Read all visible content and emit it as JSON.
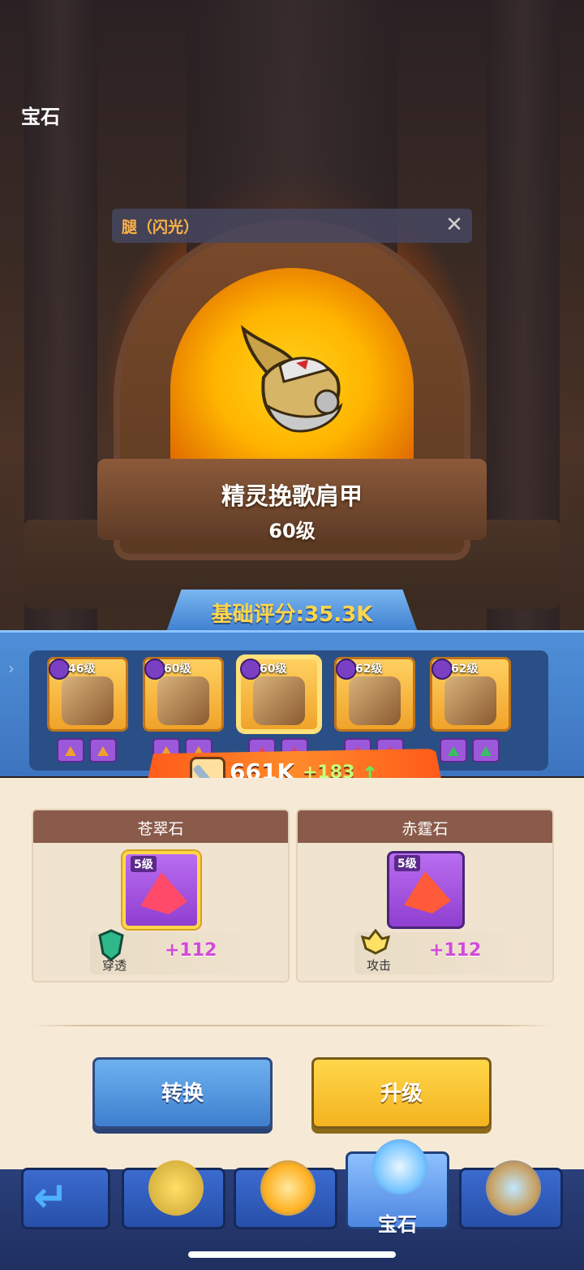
{
  "header": {
    "title": "宝石"
  },
  "slot": {
    "label": "腿（闪光）"
  },
  "item": {
    "name": "精灵挽歌肩甲",
    "level": "60级"
  },
  "score": {
    "label": "基础评分:35.3K"
  },
  "equipment": [
    {
      "level": "46级",
      "gem_color": "#f0a030",
      "selected": false
    },
    {
      "level": "60级",
      "gem_color": "#f0a030",
      "selected": false
    },
    {
      "level": "60级",
      "gem_color": "#e0406a",
      "selected": true
    },
    {
      "level": "62级",
      "gem_color": "#e0406a",
      "selected": false
    },
    {
      "level": "62级",
      "gem_color": "#38c060",
      "selected": false
    }
  ],
  "power": {
    "value": "661K",
    "delta": "+183"
  },
  "gems": [
    {
      "title": "苍翠石",
      "level": "5级",
      "stat_name": "穿透",
      "stat_value": "+112",
      "stone_color": "#ff4a6a",
      "highlighted": true
    },
    {
      "title": "赤霆石",
      "level": "5级",
      "stat_name": "攻击",
      "stat_value": "+112",
      "stone_color": "#ff5a3a",
      "highlighted": false
    }
  ],
  "actions": {
    "convert": "转换",
    "upgrade": "升级"
  },
  "nav": {
    "active_label": "宝石"
  },
  "icons": [
    "close-icon",
    "arrow-up-icon",
    "sword-icon",
    "back-arrow-icon",
    "star-icon",
    "flame-icon",
    "crystal-icon",
    "hourglass-icon"
  ]
}
